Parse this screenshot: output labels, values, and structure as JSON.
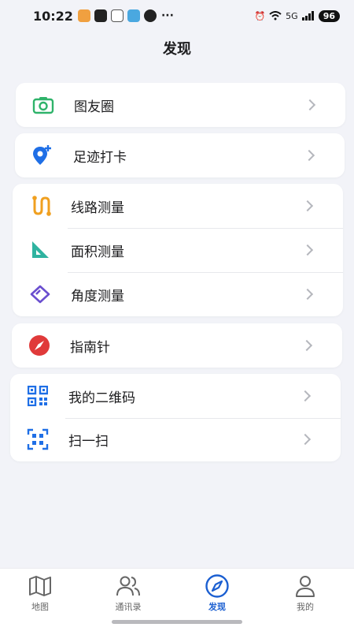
{
  "status": {
    "time": "10:22",
    "more": "···",
    "network": "5G",
    "battery": "96"
  },
  "page_title": "发现",
  "groups": [
    {
      "items": [
        {
          "label": "图友圈",
          "icon": "camera-icon",
          "color": "#2fb36a"
        }
      ]
    },
    {
      "items": [
        {
          "label": "足迹打卡",
          "icon": "location-add-icon",
          "color": "#1f6fe6"
        }
      ]
    },
    {
      "items": [
        {
          "label": "线路测量",
          "icon": "route-icon",
          "color": "#f0a020"
        },
        {
          "label": "面积测量",
          "icon": "area-icon",
          "color": "#2fb3a0"
        },
        {
          "label": "角度测量",
          "icon": "angle-icon",
          "color": "#6a4ecf"
        }
      ]
    },
    {
      "items": [
        {
          "label": "指南针",
          "icon": "compass-icon",
          "color": "#e03a3a"
        }
      ]
    },
    {
      "items": [
        {
          "label": "我的二维码",
          "icon": "qrcode-icon",
          "color": "#1f6fe6"
        },
        {
          "label": "扫一扫",
          "icon": "scan-icon",
          "color": "#1f6fe6"
        }
      ]
    }
  ],
  "tabs": [
    {
      "label": "地图",
      "icon": "map-icon"
    },
    {
      "label": "通讯录",
      "icon": "contacts-icon"
    },
    {
      "label": "发现",
      "icon": "discover-icon",
      "active": true
    },
    {
      "label": "我的",
      "icon": "profile-icon"
    }
  ],
  "colors": {
    "accent": "#1b5fd1",
    "background": "#f2f3f8"
  }
}
